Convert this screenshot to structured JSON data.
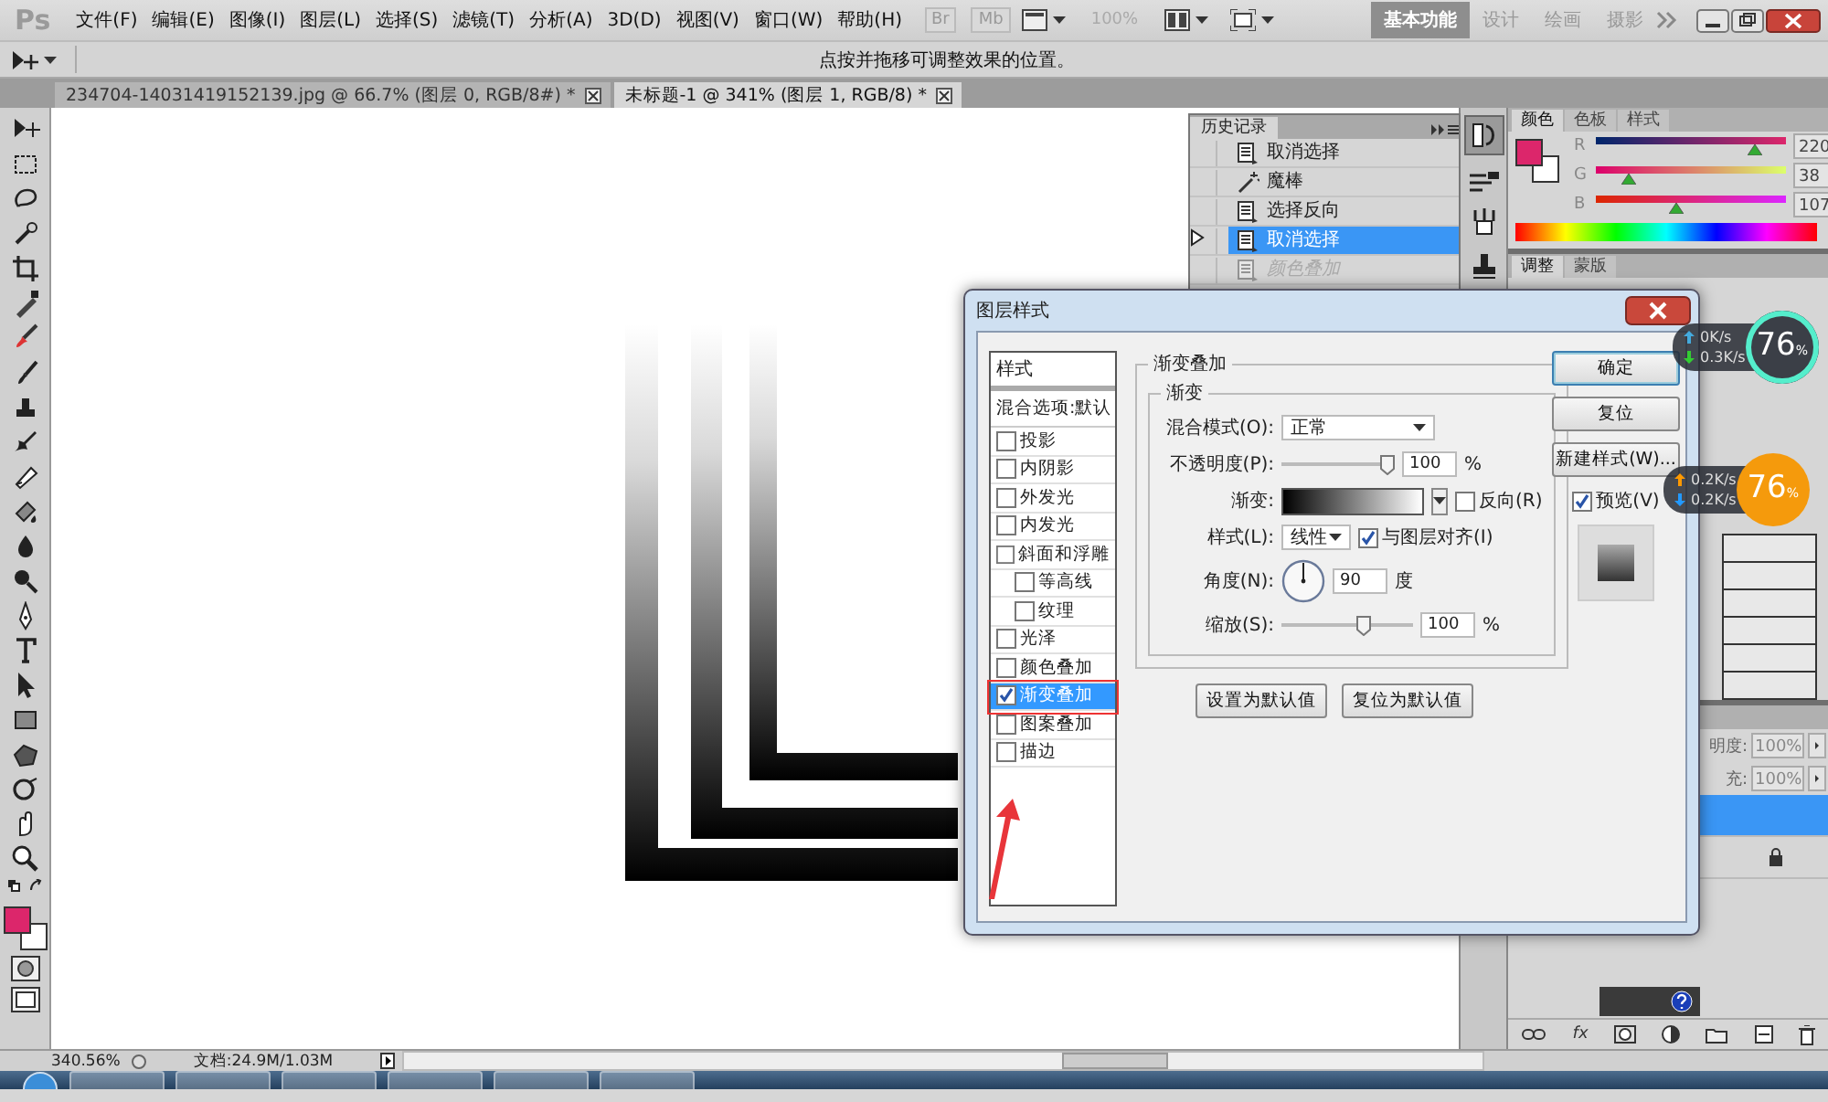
{
  "app": {
    "logo": "Ps",
    "menu": [
      "文件(F)",
      "编辑(E)",
      "图像(I)",
      "图层(L)",
      "选择(S)",
      "滤镜(T)",
      "分析(A)",
      "3D(D)",
      "视图(V)",
      "窗口(W)",
      "帮助(H)"
    ]
  },
  "app_bar": {
    "bridge": "Br",
    "mini_bridge": "Mb",
    "zoom": "100%",
    "workspaces": [
      {
        "label": "基本功能",
        "selected": true
      },
      {
        "label": "设计",
        "selected": false
      },
      {
        "label": "绘画",
        "selected": false
      },
      {
        "label": "摄影",
        "selected": false
      }
    ]
  },
  "options_bar": {
    "hint": "点按并拖移可调整效果的位置。"
  },
  "document_tabs": [
    {
      "label": "234704-14031419152139.jpg @ 66.7% (图层 0, RGB/8#) *",
      "selected": false
    },
    {
      "label": "未标题-1 @ 341% (图层 1, RGB/8) *",
      "selected": true
    }
  ],
  "history_panel": {
    "title": "历史记录",
    "items": [
      {
        "label": "取消选择",
        "kind": "command",
        "selected": false,
        "disabled": false
      },
      {
        "label": "魔棒",
        "kind": "wand",
        "selected": false,
        "disabled": false
      },
      {
        "label": "选择反向",
        "kind": "command",
        "selected": false,
        "disabled": false
      },
      {
        "label": "取消选择",
        "kind": "command",
        "selected": true,
        "disabled": false
      },
      {
        "label": "颜色叠加",
        "kind": "command",
        "selected": false,
        "disabled": true
      }
    ]
  },
  "color_panel": {
    "tabs": [
      {
        "label": "颜色",
        "selected": true
      },
      {
        "label": "色板",
        "selected": false
      },
      {
        "label": "样式",
        "selected": false
      }
    ],
    "channels": [
      {
        "name": "R",
        "value": "220",
        "level": 0.86
      },
      {
        "name": "G",
        "value": "38",
        "level": 0.15
      },
      {
        "name": "B",
        "value": "107",
        "level": 0.42
      }
    ]
  },
  "adjustments_panel": {
    "tabs": [
      {
        "label": "调整",
        "selected": true
      },
      {
        "label": "蒙版",
        "selected": false
      }
    ]
  },
  "layers_panel": {
    "opacity_label": "明度:",
    "opacity": "100%",
    "fill_label": "充:",
    "fill": "100%",
    "layers": [
      {
        "selected": true,
        "locked": false
      },
      {
        "selected": false,
        "locked": true
      }
    ],
    "fx": "fx"
  },
  "dialog": {
    "title": "图层样式",
    "styles_header": "样式",
    "blend_options": "混合选项:默认",
    "styles": [
      {
        "label": "投影",
        "checked": false,
        "selected": false
      },
      {
        "label": "内阴影",
        "checked": false,
        "selected": false
      },
      {
        "label": "外发光",
        "checked": false,
        "selected": false
      },
      {
        "label": "内发光",
        "checked": false,
        "selected": false
      },
      {
        "label": "斜面和浮雕",
        "checked": false,
        "selected": false,
        "children": [
          {
            "label": "等高线",
            "checked": false,
            "selected": false
          },
          {
            "label": "纹理",
            "checked": false,
            "selected": false
          }
        ]
      },
      {
        "label": "光泽",
        "checked": false,
        "selected": false
      },
      {
        "label": "颜色叠加",
        "checked": false,
        "selected": false
      },
      {
        "label": "渐变叠加",
        "checked": true,
        "selected": true
      },
      {
        "label": "图案叠加",
        "checked": false,
        "selected": false
      },
      {
        "label": "描边",
        "checked": false,
        "selected": false
      }
    ],
    "section_title": "渐变叠加",
    "group_title": "渐变",
    "blend_mode": {
      "label": "混合模式(O):",
      "value": "正常"
    },
    "opacity": {
      "label": "不透明度(P):",
      "level": 1,
      "value": "100",
      "unit": "%"
    },
    "gradient": {
      "label": "渐变:",
      "reverse": {
        "label": "反向(R)",
        "checked": false
      }
    },
    "style": {
      "label": "样式(L):",
      "value": "线性",
      "align": {
        "label": "与图层对齐(I)",
        "checked": true
      }
    },
    "angle": {
      "label": "角度(N):",
      "value": "90",
      "unit": "度"
    },
    "scale": {
      "label": "缩放(S):",
      "level": 0.64,
      "value": "100",
      "unit": "%"
    },
    "buttons": [
      "设置为默认值",
      "复位为默认值"
    ],
    "actions": [
      {
        "label": "确定",
        "default": true
      },
      {
        "label": "复位",
        "default": false
      },
      {
        "label": "新建样式(W)...",
        "default": false
      }
    ],
    "preview": {
      "label": "预览(V)",
      "checked": true
    }
  },
  "net_monitors": [
    {
      "kind": "ring",
      "upload": "0K/s",
      "download": "0.3K/s",
      "percent": "76",
      "unit": "%"
    },
    {
      "kind": "filled",
      "upload": "0.2K/s",
      "download": "0.2K/s",
      "percent": "76",
      "unit": "%"
    }
  ],
  "status_bar": {
    "zoom": "340.56%",
    "document": "文档:24.9M/1.03M"
  }
}
